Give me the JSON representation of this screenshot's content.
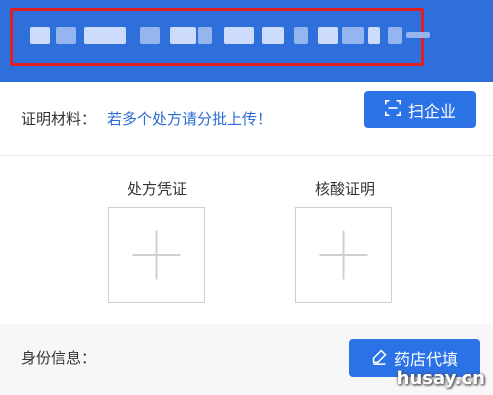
{
  "header": {
    "redacted_title": "",
    "highlight_color": "#e02020",
    "bg_color": "#2f6fdc"
  },
  "materials": {
    "label": "证明材料：",
    "hint": "若多个处方请分批上传！",
    "scan_button": {
      "label": "扫企业",
      "icon": "scan-frame-icon"
    }
  },
  "uploads": [
    {
      "title": "处方凭证",
      "icon": "plus-icon"
    },
    {
      "title": "核酸证明",
      "icon": "plus-icon"
    }
  ],
  "identity": {
    "label": "身份信息：",
    "fill_button": {
      "label": "药店代填",
      "icon": "pencil-icon"
    }
  },
  "watermark": "husay.cn"
}
